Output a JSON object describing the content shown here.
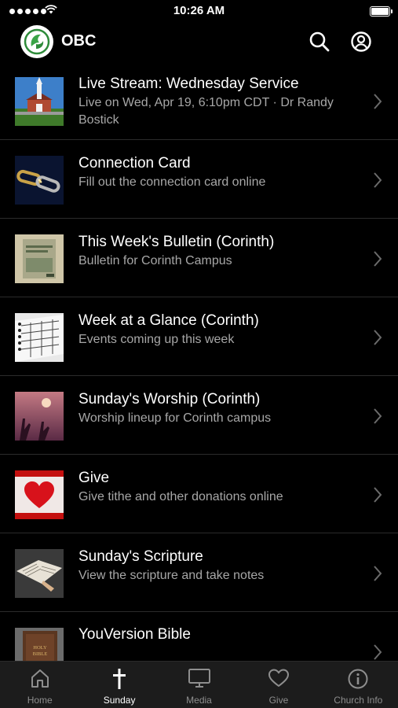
{
  "status_bar": {
    "time": "10:26 AM"
  },
  "header": {
    "title": "OBC"
  },
  "items": [
    {
      "title": "Live Stream: Wednesday Service",
      "subtitle": "Live on Wed, Apr 19, 6:10pm CDT · Dr Randy Bostick",
      "thumb": "church-building"
    },
    {
      "title": "Connection Card",
      "subtitle": "Fill out the connection card online",
      "thumb": "chain-links"
    },
    {
      "title": "This Week's Bulletin (Corinth)",
      "subtitle": "Bulletin for Corinth Campus",
      "thumb": "bulletin-page"
    },
    {
      "title": "Week at a Glance (Corinth)",
      "subtitle": "Events coming up this week",
      "thumb": "calendar-planner"
    },
    {
      "title": "Sunday's Worship (Corinth)",
      "subtitle": "Worship lineup for Corinth campus",
      "thumb": "worship-hands"
    },
    {
      "title": "Give",
      "subtitle": "Give tithe and other donations online",
      "thumb": "heart"
    },
    {
      "title": "Sunday's Scripture",
      "subtitle": "View the scripture and take notes",
      "thumb": "open-bible"
    },
    {
      "title": "YouVersion Bible",
      "subtitle": "",
      "thumb": "holy-bible-cover",
      "thumb_text": "HOLY BIBLE"
    }
  ],
  "tabs": [
    {
      "label": "Home",
      "icon": "home-icon"
    },
    {
      "label": "Sunday",
      "icon": "cross-icon",
      "active": true
    },
    {
      "label": "Media",
      "icon": "monitor-icon"
    },
    {
      "label": "Give",
      "icon": "heart-icon"
    },
    {
      "label": "Church Info",
      "icon": "info-icon"
    }
  ],
  "colors": {
    "background": "#000000",
    "tab_bar": "#1c1c1c",
    "subtitle": "#a7a7a7",
    "inactive_tab": "#8e8e8e"
  }
}
